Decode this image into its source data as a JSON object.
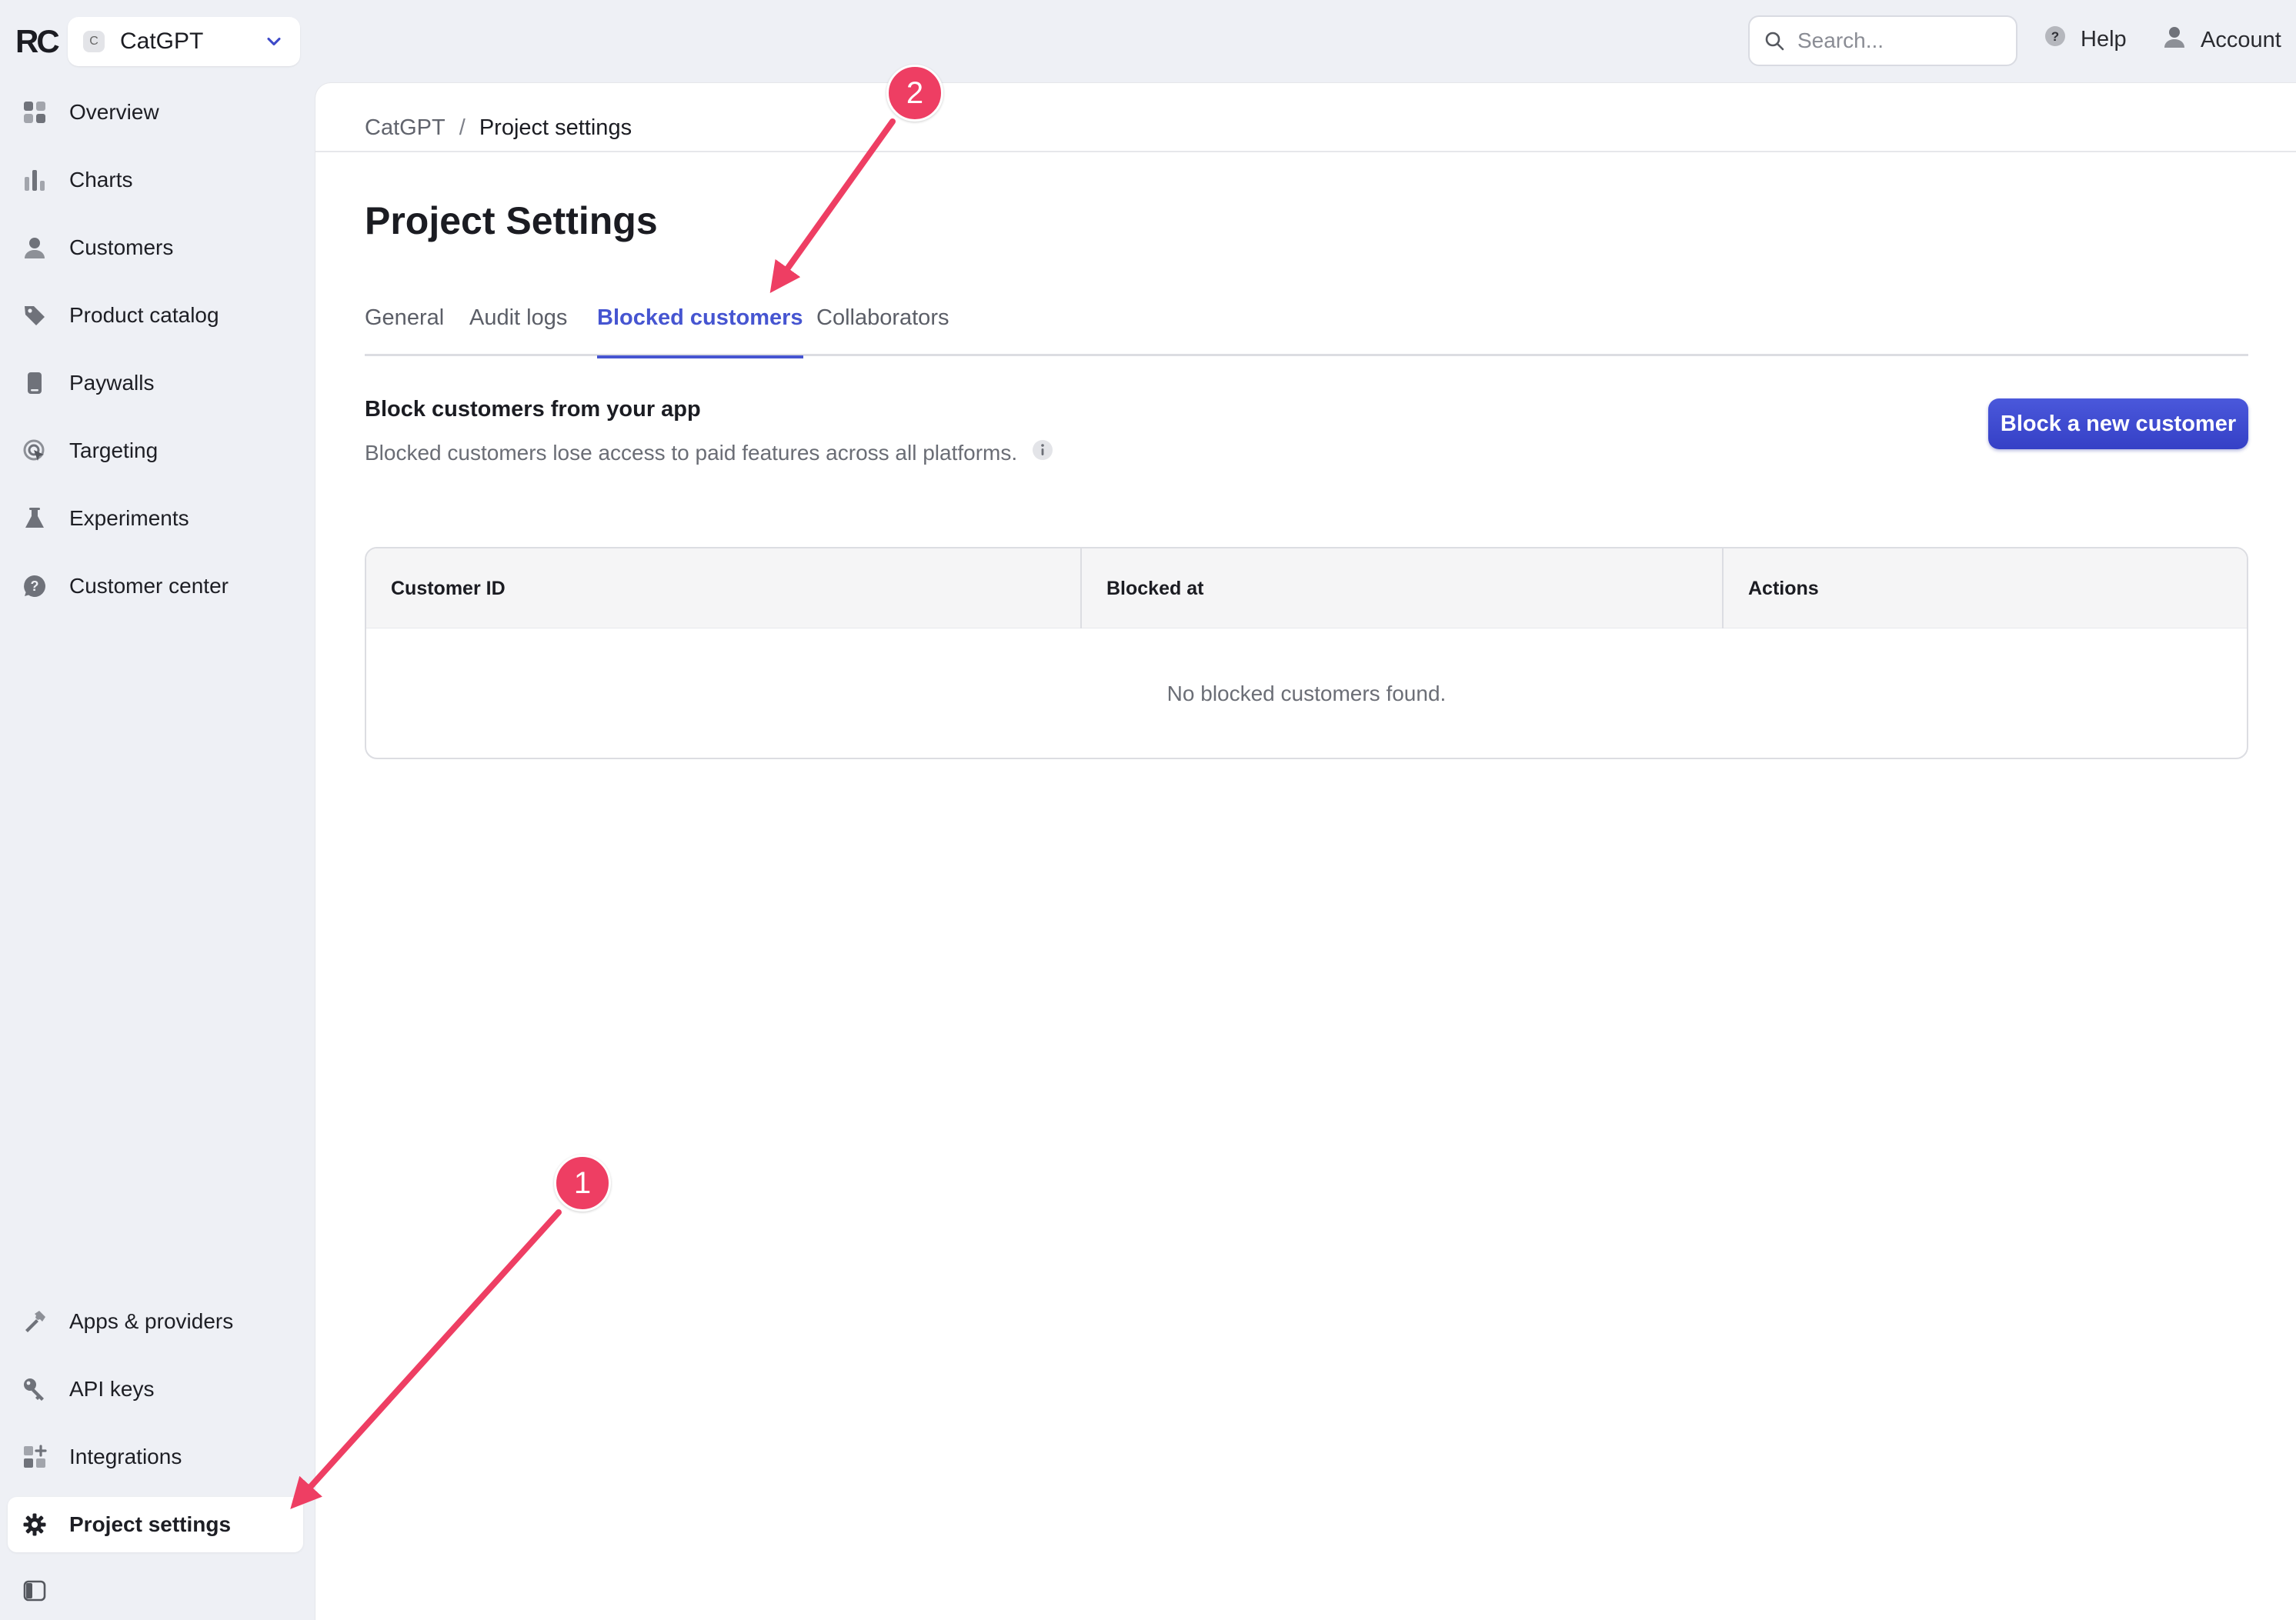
{
  "brand": {
    "logo_text": "RC"
  },
  "project_switcher": {
    "badge": "C",
    "name": "CatGPT"
  },
  "sidebar": {
    "items_top": [
      {
        "label": "Overview",
        "icon": "overview-grid-icon"
      },
      {
        "label": "Charts",
        "icon": "bar-chart-icon"
      },
      {
        "label": "Customers",
        "icon": "person-icon"
      },
      {
        "label": "Product catalog",
        "icon": "tag-icon"
      },
      {
        "label": "Paywalls",
        "icon": "phone-icon"
      },
      {
        "label": "Targeting",
        "icon": "target-icon"
      },
      {
        "label": "Experiments",
        "icon": "flask-icon"
      },
      {
        "label": "Customer center",
        "icon": "question-bubble-icon"
      }
    ],
    "items_bottom": [
      {
        "label": "Apps & providers",
        "icon": "hammer-icon"
      },
      {
        "label": "API keys",
        "icon": "key-icon"
      },
      {
        "label": "Integrations",
        "icon": "integrations-grid-icon"
      },
      {
        "label": "Project settings",
        "icon": "gear-icon",
        "active": true
      }
    ]
  },
  "topbar": {
    "search_placeholder": "Search...",
    "help_label": "Help",
    "account_label": "Account"
  },
  "breadcrumb": {
    "parent": "CatGPT",
    "separator": "/",
    "current": "Project settings"
  },
  "page": {
    "title": "Project Settings",
    "tabs": [
      {
        "label": "General"
      },
      {
        "label": "Audit logs"
      },
      {
        "label": "Blocked customers",
        "active": true
      },
      {
        "label": "Collaborators"
      }
    ],
    "section_title": "Block customers from your app",
    "section_desc": "Blocked customers lose access to paid features across all platforms.",
    "primary_button": "Block a new customer",
    "table": {
      "columns": [
        "Customer ID",
        "Blocked at",
        "Actions"
      ],
      "empty_text": "No blocked customers found."
    }
  },
  "annotations": {
    "badge_1": "1",
    "badge_2": "2",
    "color": "#ee3e63"
  },
  "colors": {
    "accent": "#4655d1",
    "button": "#3d49d0",
    "annotation": "#ee3e63"
  }
}
